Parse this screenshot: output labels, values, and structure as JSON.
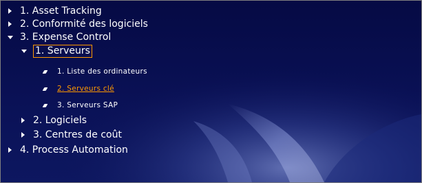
{
  "tree": {
    "items": [
      {
        "label": "1. Asset Tracking",
        "state": "collapsed"
      },
      {
        "label": "2. Conformité des logiciels",
        "state": "collapsed"
      },
      {
        "label": "3. Expense Control",
        "state": "expanded",
        "children": [
          {
            "label": "1. Serveurs",
            "state": "expanded",
            "selected": true,
            "children": [
              {
                "label": "1. Liste des ordinateurs"
              },
              {
                "label": "2. Serveurs clé",
                "current": true
              },
              {
                "label": "3. Serveurs SAP"
              }
            ]
          },
          {
            "label": "2. Logiciels",
            "state": "collapsed"
          },
          {
            "label": "3. Centres de coût",
            "state": "collapsed"
          }
        ]
      },
      {
        "label": "4. Process Automation",
        "state": "collapsed"
      }
    ]
  },
  "colors": {
    "background": "#0a1156",
    "text": "#ffffff",
    "highlight": "#ff9900",
    "border": "#7f7f7f"
  },
  "icons": {
    "collapsed": "triangle-right-icon",
    "expanded": "triangle-down-icon",
    "leaf": "bullet-icon"
  }
}
